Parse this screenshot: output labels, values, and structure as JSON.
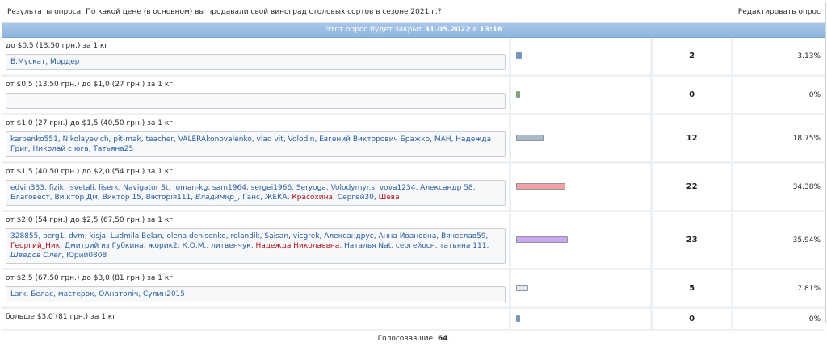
{
  "header": {
    "title": "Результаты опроса: По какой цене (в основном) вы продавали свой виноград столовых сортов в сезоне 2021 г.?",
    "edit_label": "Редактировать опрос"
  },
  "closing": {
    "prefix": "Этот опрос будет закрыт",
    "date": "31.05.2022",
    "middle": "в",
    "time": "13:16"
  },
  "options": [
    {
      "label": "до $0,5 (13,50 грн.) за 1 кг",
      "count": "2",
      "percent": "3.13%",
      "fraction": 0.0313,
      "bar_color": "#6f95cf",
      "voters": [
        {
          "name": "В.Мускат"
        },
        {
          "name": "Мордер"
        }
      ]
    },
    {
      "label": "от $0,5 (13,50 грн.) до $1,0 (27 грн.) за 1 кг",
      "count": "0",
      "percent": "0%",
      "fraction": 0,
      "bar_color": "#7fb04e",
      "voters": []
    },
    {
      "label": "от $1,0 (27 грн.) до $1,5 (40,50 грн.) за 1 кг",
      "count": "12",
      "percent": "18.75%",
      "fraction": 0.1875,
      "bar_color": "#a9b9c8",
      "voters": [
        {
          "name": "karpenko551"
        },
        {
          "name": "Nikolayevich"
        },
        {
          "name": "pit-mak"
        },
        {
          "name": "teacher"
        },
        {
          "name": "VALERAkonovalenko"
        },
        {
          "name": "vlad vit"
        },
        {
          "name": "Volodin"
        },
        {
          "name": "Евгений Викторович Бражко"
        },
        {
          "name": "МАН"
        },
        {
          "name": "Надежда Григ"
        },
        {
          "name": "Николай с юга"
        },
        {
          "name": "Татьяна25"
        }
      ]
    },
    {
      "label": "от $1,5 (40,50 грн.) до $2,0 (54 грн.) за 1 кг",
      "count": "22",
      "percent": "34.38%",
      "fraction": 0.3438,
      "bar_color": "#f2a2a6",
      "voters": [
        {
          "name": "edvin333"
        },
        {
          "name": "fizik"
        },
        {
          "name": "isvetali"
        },
        {
          "name": "liserk"
        },
        {
          "name": "Navigator St"
        },
        {
          "name": "roman-kg"
        },
        {
          "name": "sam1964"
        },
        {
          "name": "sergei1966"
        },
        {
          "name": "Seryoga"
        },
        {
          "name": "Volodymyr.s"
        },
        {
          "name": "vova1234"
        },
        {
          "name": "Александр 58"
        },
        {
          "name": "Благовест"
        },
        {
          "name": "Ви.ктор Дм"
        },
        {
          "name": "Виктор 15"
        },
        {
          "name": "Вікторія111"
        },
        {
          "name": "Владимир_",
          "style": "it"
        },
        {
          "name": "Ганс"
        },
        {
          "name": "ЖЕКА"
        },
        {
          "name": "Красохина",
          "style": "red"
        },
        {
          "name": "Сергей30"
        },
        {
          "name": "Шева",
          "style": "red"
        }
      ]
    },
    {
      "label": "от $2,0 (54 грн.) до $2,5 (67,50 грн.) за 1 кг",
      "count": "23",
      "percent": "35.94%",
      "fraction": 0.3594,
      "bar_color": "#c9a6ef",
      "voters": [
        {
          "name": "328855"
        },
        {
          "name": "berg1"
        },
        {
          "name": "dvm"
        },
        {
          "name": "kisja"
        },
        {
          "name": "Ludmila Belan"
        },
        {
          "name": "olena denisenko"
        },
        {
          "name": "rolandik"
        },
        {
          "name": "Saisan"
        },
        {
          "name": "vicgrek"
        },
        {
          "name": "Александрус"
        },
        {
          "name": "Анна Ивановна"
        },
        {
          "name": "Вячеслав59"
        },
        {
          "name": "Георгий_Ник",
          "style": "red"
        },
        {
          "name": "Дмитрий из Губкина"
        },
        {
          "name": "жорик2"
        },
        {
          "name": "К.О.М."
        },
        {
          "name": "литвенчук"
        },
        {
          "name": "Надежда Николаевна",
          "style": "red"
        },
        {
          "name": "Наталья Nat"
        },
        {
          "name": "сергейосн"
        },
        {
          "name": "татьяна 111"
        },
        {
          "name": "Шведов Олег",
          "style": "it"
        },
        {
          "name": "Юрий0808"
        }
      ]
    },
    {
      "label": "от $2,5 (67,50 грн.) до $3,0 (81 грн.) за 1 кг",
      "count": "5",
      "percent": "7.81%",
      "fraction": 0.0781,
      "bar_color": "#e6e8eb",
      "voters": [
        {
          "name": "Lark"
        },
        {
          "name": "Белас"
        },
        {
          "name": "мастерок"
        },
        {
          "name": "ОАнатоліч"
        },
        {
          "name": "Сулин2015"
        }
      ]
    },
    {
      "label": "больше $3,0 (81 грн.) за 1 кг",
      "count": "0",
      "percent": "0%",
      "fraction": 0,
      "bar_color": "#6f95cf",
      "voters": null
    }
  ],
  "footer": {
    "prefix": "Голосовавшие:",
    "total": "64"
  }
}
